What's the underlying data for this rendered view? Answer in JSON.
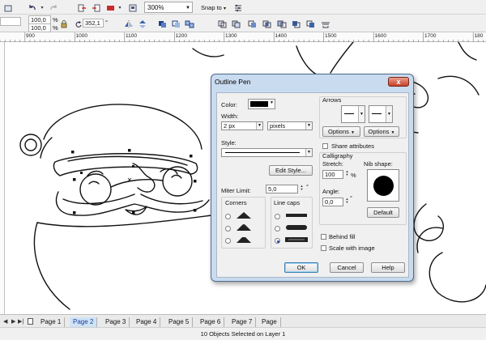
{
  "toolbar": {
    "zoom": "300%",
    "snap_to": "Snap to",
    "scale_x": "100,0",
    "scale_y": "100,0",
    "percent_sign": "%",
    "rotation": "352,1",
    "degree_sign": "°"
  },
  "ruler": {
    "labels": [
      "900",
      "1000",
      "1100",
      "1200",
      "1300",
      "1400",
      "1500",
      "1600",
      "1700",
      "180"
    ]
  },
  "dialog": {
    "title": "Outline Pen",
    "close": "x",
    "color_label": "Color:",
    "color_value": "#000000",
    "width_label": "Width:",
    "width_value": "2 px",
    "width_unit": "pixels",
    "style_label": "Style:",
    "edit_style": "Edit Style...",
    "miter_label": "Miter Limit:",
    "miter_value": "5,0",
    "degree": "°",
    "corners_label": "Corners",
    "linecaps_label": "Line caps",
    "arrows_label": "Arrows",
    "options_left": "Options",
    "options_right": "Options",
    "share_attributes": "Share attributes",
    "calligraphy_label": "Calligraphy",
    "stretch_label": "Stretch:",
    "stretch_value": "100",
    "stretch_unit": "%",
    "nib_label": "Nib shape:",
    "angle_label": "Angle:",
    "angle_value": "0,0",
    "default_btn": "Default",
    "behind_fill": "Behind fill",
    "scale_with_image": "Scale with image",
    "ok": "OK",
    "cancel": "Cancel",
    "help": "Help",
    "selected_linecap": 2
  },
  "pages": {
    "tabs": [
      "Page 1",
      "Page 2",
      "Page 3",
      "Page 4",
      "Page 5",
      "Page 6",
      "Page 7",
      "Page"
    ],
    "active_index": 1
  },
  "status": {
    "text": "10 Objects Selected on Layer 1"
  }
}
